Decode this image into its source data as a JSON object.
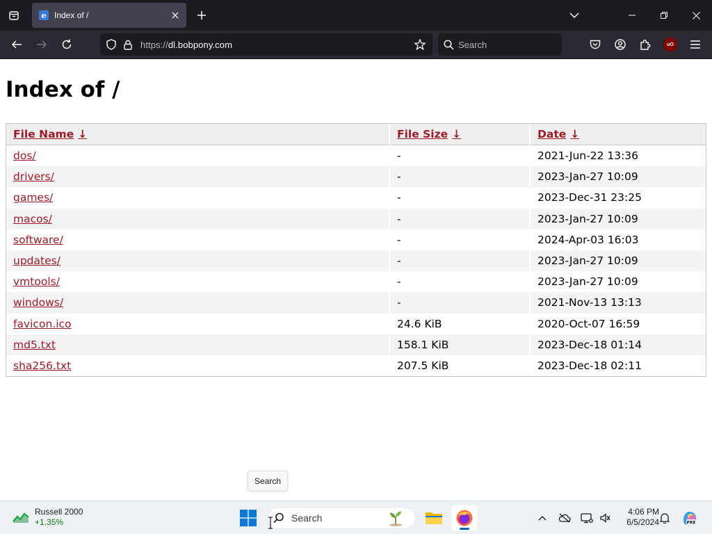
{
  "browser": {
    "tab": {
      "title": "Index of /"
    },
    "url": {
      "scheme": "https://",
      "host": "dl.bobpony.com"
    },
    "search": {
      "placeholder": "Search"
    },
    "ublock_badge": "uO"
  },
  "page": {
    "title": "Index of /",
    "columns": [
      {
        "label": "File Name",
        "arrow": "↓"
      },
      {
        "label": "File Size",
        "arrow": "↓"
      },
      {
        "label": "Date",
        "arrow": "↓"
      }
    ],
    "rows": [
      {
        "name": "dos/",
        "size": "-",
        "date": "2021-Jun-22 13:36"
      },
      {
        "name": "drivers/",
        "size": "-",
        "date": "2023-Jan-27 10:09"
      },
      {
        "name": "games/",
        "size": "-",
        "date": "2023-Dec-31 23:25"
      },
      {
        "name": "macos/",
        "size": "-",
        "date": "2023-Jan-27 10:09"
      },
      {
        "name": "software/",
        "size": "-",
        "date": "2024-Apr-03 16:03"
      },
      {
        "name": "updates/",
        "size": "-",
        "date": "2023-Jan-27 10:09"
      },
      {
        "name": "vmtools/",
        "size": "-",
        "date": "2023-Jan-27 10:09"
      },
      {
        "name": "windows/",
        "size": "-",
        "date": "2021-Nov-13 13:13"
      },
      {
        "name": "favicon.ico",
        "size": "24.6 KiB",
        "date": "2020-Oct-07 16:59"
      },
      {
        "name": "md5.txt",
        "size": "158.1 KiB",
        "date": "2023-Dec-18 01:14"
      },
      {
        "name": "sha256.txt",
        "size": "207.5 KiB",
        "date": "2023-Dec-18 02:11"
      }
    ]
  },
  "tooltip": {
    "text": "Search"
  },
  "taskbar": {
    "widget": {
      "title": "Russell 2000",
      "change": "+1.35%"
    },
    "search": {
      "label": "Search"
    },
    "clock": {
      "time": "4:06 PM",
      "date": "6/5/2024"
    },
    "copilot_badge": "PRE"
  },
  "colors": {
    "link": "#9b1c28",
    "header_bg": "#eeeeee",
    "alt_row_bg": "#f3f3f3",
    "tabstrip_bg": "#1c1b22",
    "navbar_bg": "#2b2a33",
    "taskbar_bg": "#eef1f6",
    "widget_positive": "#107c10"
  },
  "icons": {
    "tabstrip": [
      "tab-list-icon",
      "ie-favicon-icon",
      "close-icon",
      "plus-icon",
      "chevron-down-icon",
      "minimize-icon",
      "restore-icon",
      "close-window-icon"
    ],
    "navbar": [
      "back-arrow-icon",
      "forward-arrow-icon",
      "reload-icon",
      "shield-icon",
      "lock-icon",
      "star-icon",
      "search-icon",
      "pocket-icon",
      "account-icon",
      "extensions-icon",
      "ublock-icon",
      "hamburger-menu-icon"
    ],
    "taskbar": [
      "stock-chart-icon",
      "windows-start-icon",
      "search-icon",
      "plant-icon",
      "file-explorer-icon",
      "firefox-icon",
      "chevron-up-icon",
      "onedrive-icon",
      "network-icon",
      "volume-icon",
      "bell-icon",
      "copilot-icon"
    ]
  }
}
